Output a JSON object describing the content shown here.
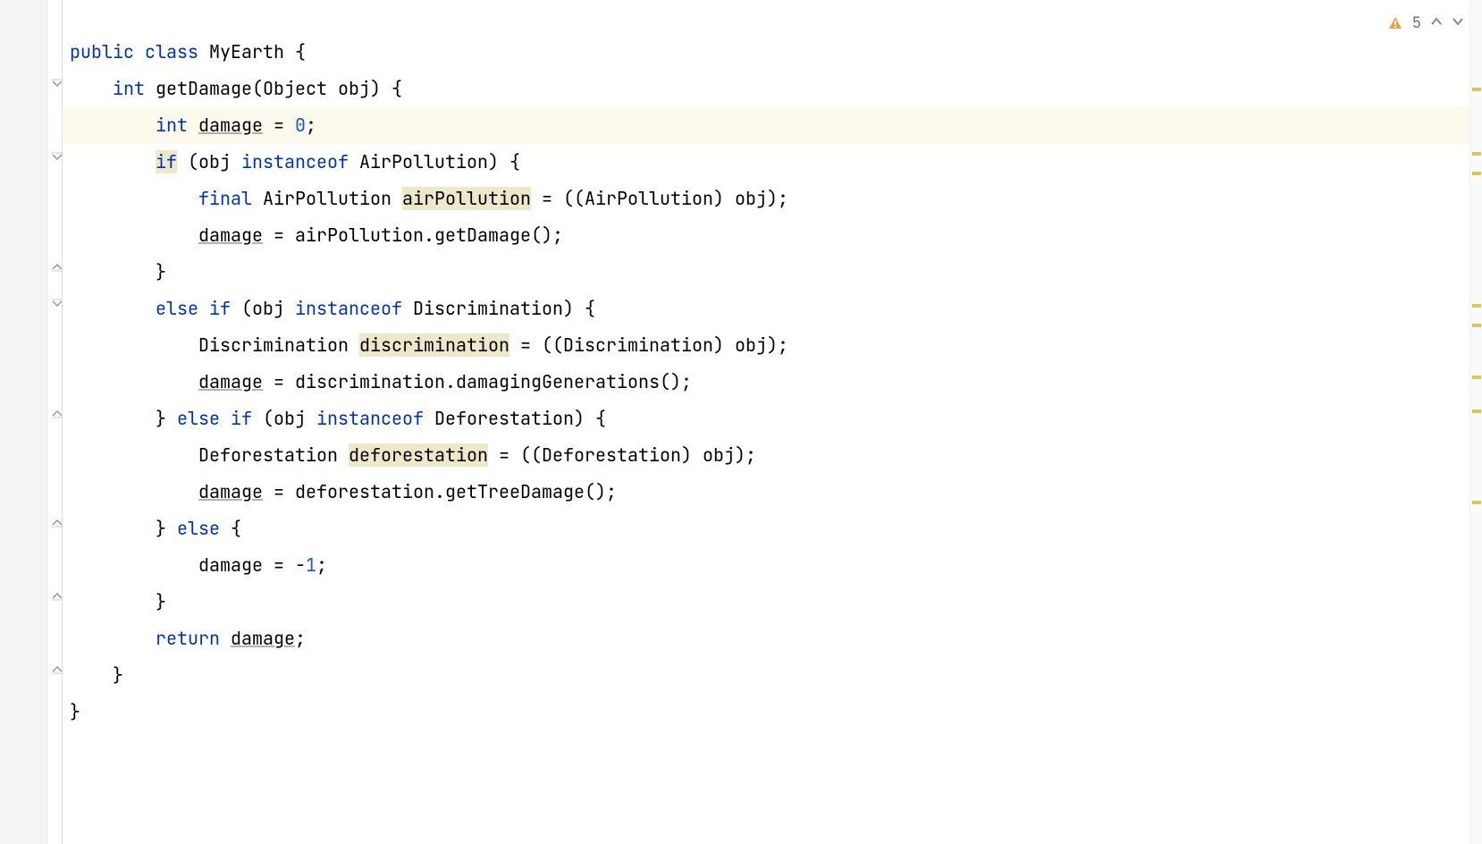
{
  "inspection": {
    "warning_count": "5"
  },
  "fold_positions": [
    88,
    170,
    292,
    334,
    455,
    578,
    658,
    740
  ],
  "stripe_positions": [
    98,
    170,
    192,
    340,
    362,
    420,
    458,
    560
  ],
  "code": {
    "l1": {
      "kw1": "public",
      "kw2": "class",
      "name": "MyEarth",
      "brace": " {"
    },
    "l2": {
      "ind": "    ",
      "kw": "int",
      "name": " getDamage(Object obj) {",
      "pre": " "
    },
    "l3": {
      "ind": "        ",
      "kw": "int",
      "var": "damage",
      "rest": " = ",
      "num": "0",
      "semi": ";"
    },
    "l4": {
      "ind": "        ",
      "kw": "if",
      "p1": " (obj ",
      "kw2": "instanceof",
      "p2": " AirPollution) {"
    },
    "l5": {
      "ind": "            ",
      "kw": "final",
      "type": " AirPollution ",
      "var": "airPollution",
      "rest": " = ((AirPollution) obj);"
    },
    "l6": {
      "ind": "            ",
      "var": "damage",
      "rest": " = airPollution.getDamage();"
    },
    "l7": {
      "ind": "        ",
      "brace": "}"
    },
    "l8": {
      "ind": "        ",
      "kw1": "else",
      "kw2": "if",
      "p1": " (obj ",
      "kw3": "instanceof",
      "p2": " Discrimination) {"
    },
    "l9": {
      "ind": "            ",
      "type": "Discrimination ",
      "var": "discrimination",
      "rest": " = ((Discrimination) obj);"
    },
    "l10": {
      "ind": "            ",
      "var": "damage",
      "rest": " = discrimination.damagingGenerations();"
    },
    "l11": {
      "ind": "        ",
      "brace": "} ",
      "kw1": "else",
      "kw2": "if",
      "p1": " (obj ",
      "kw3": "instanceof",
      "p2": " Deforestation) {"
    },
    "l12": {
      "ind": "            ",
      "type": "Deforestation ",
      "var": "deforestation",
      "rest": " = ((Deforestation) obj);"
    },
    "l13": {
      "ind": "            ",
      "var": "damage",
      "rest": " = deforestation.getTreeDamage();"
    },
    "l14": {
      "ind": "        ",
      "brace": "} ",
      "kw": "else",
      "brace2": " {"
    },
    "l15": {
      "ind": "            ",
      "var": "damage",
      "rest": " = -",
      "num": "1",
      "semi": ";"
    },
    "l16": {
      "ind": "        ",
      "brace": "}"
    },
    "l17": {
      "ind": "        ",
      "kw": "return",
      "var": "damage",
      "semi": ";"
    },
    "l18": {
      "ind": "    ",
      "brace": "}"
    },
    "l19": {
      "ind": "",
      "brace": "}"
    }
  }
}
